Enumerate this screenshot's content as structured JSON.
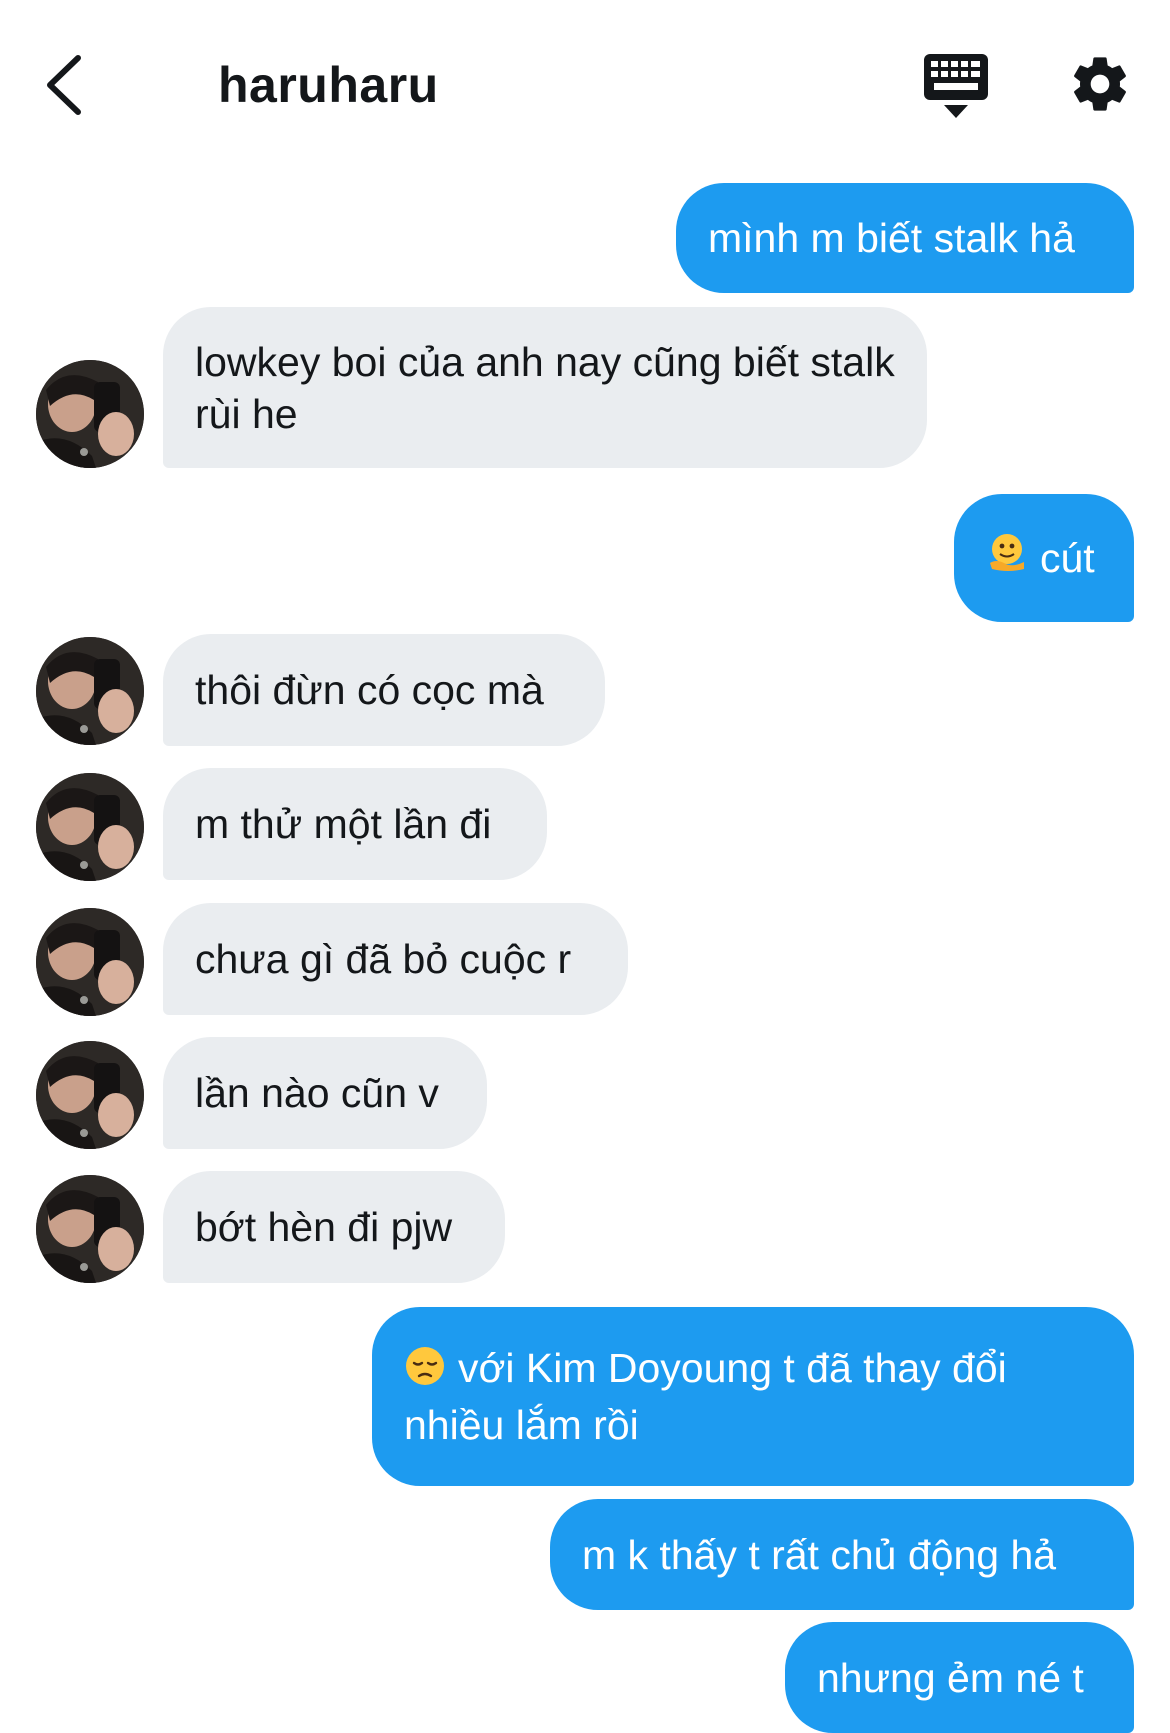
{
  "header": {
    "title": "haruharu",
    "icons": [
      "back-icon",
      "keyboard-icon",
      "gear-icon"
    ]
  },
  "colors": {
    "outgoing_bubble": "#1d9bf0",
    "incoming_bubble": "#eaedf0",
    "text_dark": "#14171a"
  },
  "messages": [
    {
      "from": "me",
      "text": "mình m biết stalk hả"
    },
    {
      "from": "them",
      "text": "lowkey boi của anh nay cũng biết stalk rùi he"
    },
    {
      "from": "me",
      "emoji": "melting-face-emoji",
      "text": "cút"
    },
    {
      "from": "them",
      "text": "thôi đừn có cọc mà"
    },
    {
      "from": "them",
      "text": "m thử một lần đi"
    },
    {
      "from": "them",
      "text": "chưa gì đã bỏ cuộc r"
    },
    {
      "from": "them",
      "text": "lần nào cũn v"
    },
    {
      "from": "them",
      "text": "bớt hèn đi pjw"
    },
    {
      "from": "me",
      "emoji": "pensive-face-emoji",
      "text": "với Kim Doyoung t đã thay đổi nhiều lắm rồi"
    },
    {
      "from": "me",
      "text": "m k thấy t rất chủ động hả"
    },
    {
      "from": "me",
      "text": "nhưng ẻm né t"
    }
  ]
}
